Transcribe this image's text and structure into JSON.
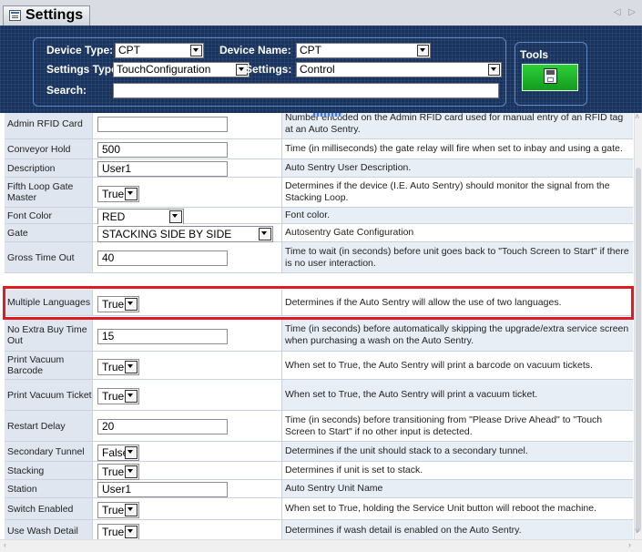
{
  "window": {
    "title": "Settings",
    "icon": "settings-window-icon",
    "nav_arrows": "◁ ▷"
  },
  "filters": {
    "device_type_label": "Device Type:",
    "device_type_value": "CPT",
    "device_name_label": "Device Name:",
    "device_name_value": "CPT",
    "settings_type_label": "Settings Type",
    "settings_type_value": "TouchConfiguration",
    "settings_label": "Settings:",
    "settings_value": "Control",
    "search_label": "Search:",
    "search_value": ""
  },
  "tools": {
    "label": "Tools",
    "save_icon": "floppy-disk-icon"
  },
  "rows": [
    {
      "name": "Admin RFID Card",
      "kind": "input",
      "value": "",
      "description": "Number encoded on the Admin RFID card used for manual entry of an RFID tag at an Auto Sentry."
    },
    {
      "name": "Conveyor Hold",
      "kind": "input",
      "value": "500",
      "description": "Time (in milliseconds) the gate relay will fire when set to inbay and using a gate."
    },
    {
      "name": "Description",
      "kind": "input",
      "value": "User1",
      "description": "Auto Sentry User Description."
    },
    {
      "name": "Fifth Loop Gate Master",
      "kind": "select",
      "value": "True",
      "description": "Determines if the device (I.E. Auto Sentry) should monitor the signal from the Stacking Loop."
    },
    {
      "name": "Font Color",
      "kind": "select",
      "value": "RED",
      "description": "Font color."
    },
    {
      "name": "Gate",
      "kind": "select",
      "value": "STACKING SIDE BY SIDE",
      "description": "Autosentry Gate Configuration"
    },
    {
      "name": "Gross Time Out",
      "kind": "input",
      "value": "40",
      "description": "Time to wait (in seconds) before unit goes back to \"Touch Screen to Start\" if there is no user interaction."
    },
    {
      "name": "Multiple Languages",
      "kind": "select",
      "value": "True",
      "description": "Determines if the Auto Sentry will allow the use of two languages."
    },
    {
      "name": "No Extra Buy Time Out",
      "kind": "input",
      "value": "15",
      "description": "Time (in seconds) before automatically skipping the upgrade/extra service screen when purchasing a wash on the Auto Sentry."
    },
    {
      "name": "Print Vacuum Barcode",
      "kind": "select",
      "value": "True",
      "description": "When set to True, the Auto Sentry will print a barcode on vacuum tickets."
    },
    {
      "name": "Print Vacuum Ticket",
      "kind": "select",
      "value": "True",
      "description": "When set to True, the Auto Sentry will print a vacuum ticket."
    },
    {
      "name": "Restart Delay",
      "kind": "input",
      "value": "20",
      "description": "Time (in seconds) before transitioning from \"Please Drive Ahead\" to \"Touch Screen to Start\" if no other input is detected."
    },
    {
      "name": "Secondary Tunnel",
      "kind": "select",
      "value": "False",
      "description": "Determines if the unit should stack to a secondary tunnel."
    },
    {
      "name": "Stacking",
      "kind": "select",
      "value": "True",
      "description": "Determines if unit is set to stack."
    },
    {
      "name": "Station",
      "kind": "input",
      "value": "User1",
      "description": "Auto Sentry Unit Name"
    },
    {
      "name": "Switch Enabled",
      "kind": "select",
      "value": "True",
      "description": "When set to True, holding the Service Unit button will reboot the machine."
    },
    {
      "name": "Use Wash Detail",
      "kind": "select",
      "value": "True",
      "description": "Determines if wash detail is enabled on the Auto Sentry."
    }
  ],
  "highlighted_row": "Multiple Languages"
}
